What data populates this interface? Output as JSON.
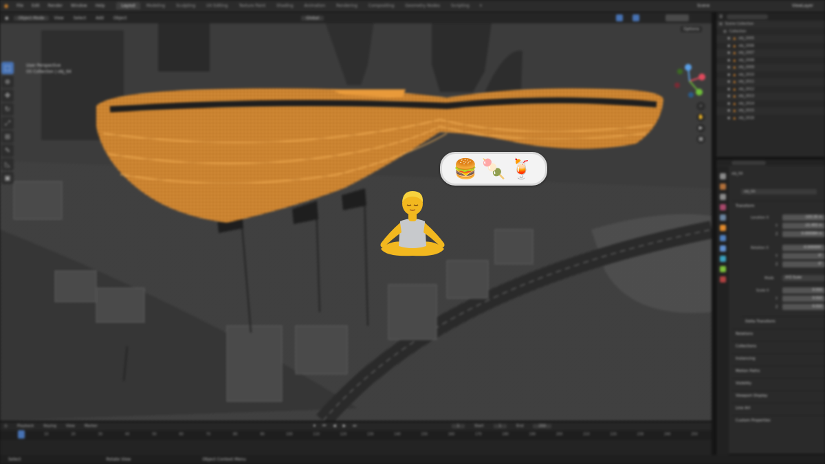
{
  "topbar": {
    "menus": [
      "File",
      "Edit",
      "Render",
      "Window",
      "Help"
    ],
    "workspaces": [
      "Layout",
      "Modeling",
      "Sculpting",
      "UV Editing",
      "Texture Paint",
      "Shading",
      "Animation",
      "Rendering",
      "Compositing",
      "Geometry Nodes",
      "Scripting"
    ],
    "active_workspace": "Layout",
    "scene": "Scene",
    "view_layer": "ViewLayer"
  },
  "viewport_header": {
    "mode": "Object Mode",
    "menus": [
      "View",
      "Select",
      "Add",
      "Object"
    ],
    "transform_orientation": "Global",
    "options": "Options"
  },
  "viewport_info": {
    "view_name": "User Perspective",
    "collection_object": "(0) Collection | obj_64"
  },
  "outliner": {
    "root": "Scene Collection",
    "collection": "Collection",
    "objects": [
      "obj_2005",
      "obj_2006",
      "obj_2007",
      "obj_2008",
      "obj_2009",
      "obj_2010",
      "obj_2011",
      "obj_2012",
      "obj_2013",
      "obj_2014",
      "obj_2015",
      "obj_2016"
    ]
  },
  "properties": {
    "object_name": "obj_64",
    "panel_transform": "Transform",
    "location_label": "Location X",
    "location": [
      "-103.35 m",
      "-21.455 m",
      "0.000084 m"
    ],
    "rotation_label": "Rotation X",
    "rotation": [
      "-0.000009°",
      "0°",
      "0°"
    ],
    "mode_label": "Mode",
    "mode_value": "XYZ Euler",
    "scale_label": "Scale X",
    "scale": [
      "0.010",
      "0.010",
      "0.010"
    ],
    "axis_y": "Y",
    "axis_z": "Z",
    "delta_transform": "Delta Transform",
    "sections": [
      "Relations",
      "Collections",
      "Instancing",
      "Motion Paths",
      "Visibility",
      "Viewport Display",
      "Line Art",
      "Custom Properties"
    ]
  },
  "timeline": {
    "menus": [
      "Playback",
      "Keying",
      "View",
      "Marker"
    ],
    "current_frame": "1",
    "start_label": "Start",
    "start_value": "1",
    "end_label": "End",
    "end_value": "250",
    "ticks": [
      "0",
      "10",
      "20",
      "30",
      "40",
      "50",
      "60",
      "70",
      "80",
      "90",
      "100",
      "110",
      "120",
      "130",
      "140",
      "150",
      "160",
      "170",
      "180",
      "190",
      "200",
      "210",
      "220",
      "230",
      "240",
      "250"
    ]
  },
  "statusbar": [
    "Select",
    "Rotate View",
    "Object Context Menu"
  ],
  "overlay_emojis": {
    "popup": [
      "🍔",
      "🍡",
      "🍹"
    ],
    "person": "person-in-lotus-position"
  },
  "colors": {
    "selection_orange": "#f0a040",
    "active_blue": "#4772b3",
    "popup_bg": "#f3f3f3"
  }
}
